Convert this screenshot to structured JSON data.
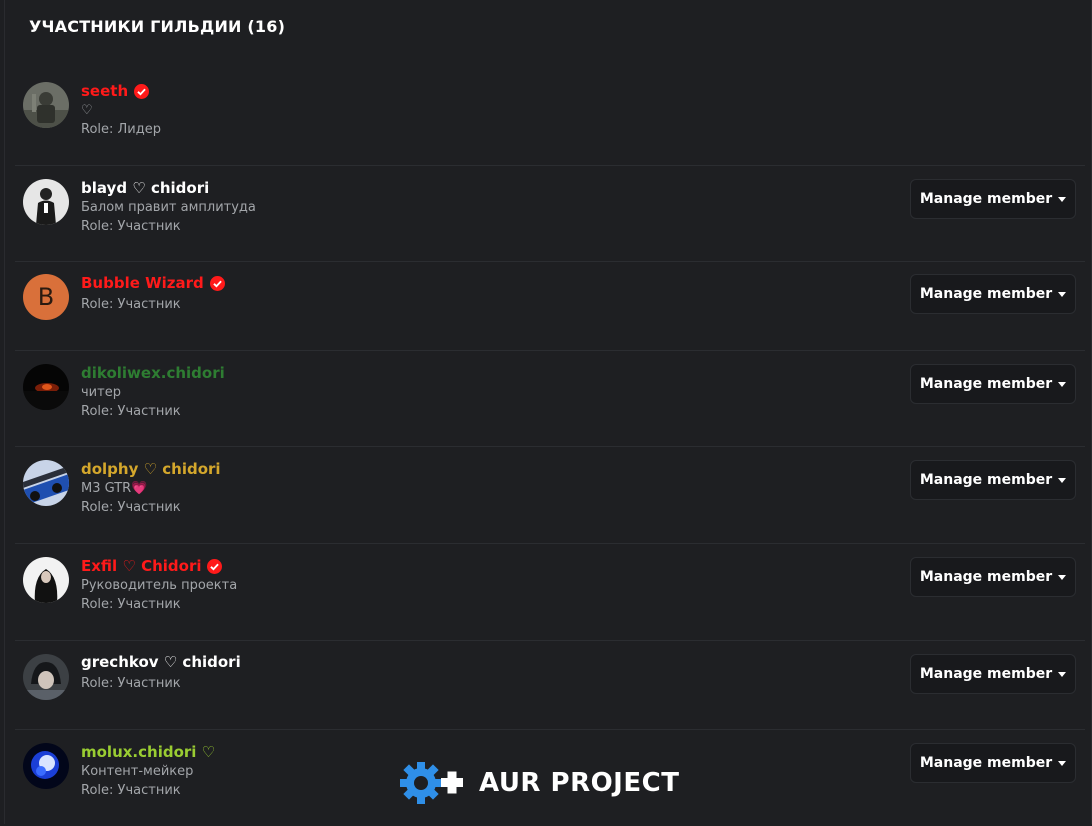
{
  "header": {
    "title": "УЧАСТНИКИ ГИЛЬДИИ (16)"
  },
  "manage_label": "Manage member",
  "watermark": {
    "text": "AUR PROJECT"
  },
  "colors": {
    "red": "#ff1a1a",
    "green": "#2e7d32",
    "gold": "#d4a72c",
    "lime": "#9acd32",
    "white": "#ffffff",
    "verified": "#ff1a1a"
  },
  "members": [
    {
      "name": "seeth",
      "name_color": "#ff1a1a",
      "verified": true,
      "subtitle": "♡",
      "role": "Role: Лидер",
      "manageable": false
    },
    {
      "name": "blayd ♡ chidori",
      "name_color": "#ffffff",
      "verified": false,
      "subtitle": "Балом правит амплитуда",
      "role": "Role: Участник",
      "manageable": true
    },
    {
      "name": "Bubble Wizard",
      "name_color": "#ff1a1a",
      "verified": true,
      "subtitle": "",
      "role": "Role: Участник",
      "manageable": true,
      "avatar_letter": "B"
    },
    {
      "name": "dikoliwex.chidori",
      "name_color": "#2e7d32",
      "verified": false,
      "subtitle": "читер",
      "role": "Role: Участник",
      "manageable": true
    },
    {
      "name": "dolphy ♡ chidori",
      "name_color": "#d4a72c",
      "verified": false,
      "subtitle": "M3 GTR💗",
      "role": "Role: Участник",
      "manageable": true
    },
    {
      "name": "Exfil ♡ Chidori",
      "name_color": "#ff1a1a",
      "verified": true,
      "subtitle": "Руководитель проекта",
      "role": "Role: Участник",
      "manageable": true
    },
    {
      "name": "grechkov ♡ chidori",
      "name_color": "#ffffff",
      "verified": false,
      "subtitle": "",
      "role": "Role: Участник",
      "manageable": true
    },
    {
      "name": "molux.chidori ♡",
      "name_color": "#9acd32",
      "verified": false,
      "subtitle": "Контент-мейкер",
      "role": "Role: Участник",
      "manageable": true
    }
  ]
}
